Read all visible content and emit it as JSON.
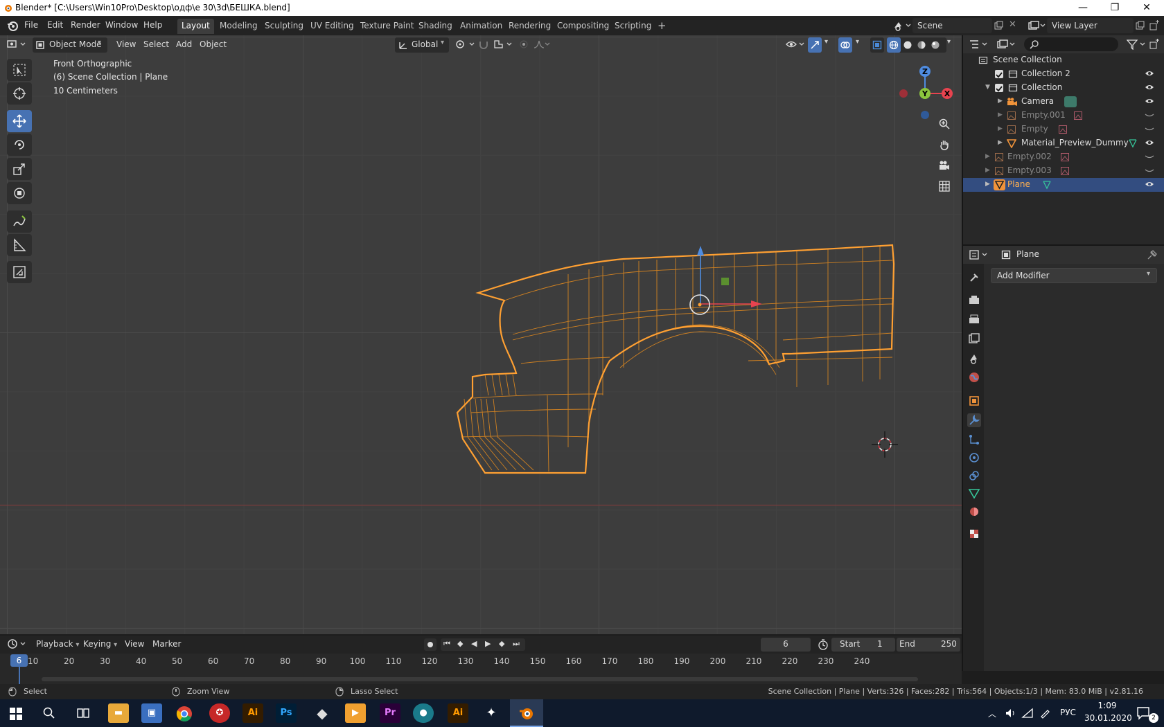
{
  "window": {
    "title": "Blender* [C:\\Users\\Win10Pro\\Desktop\\одф\\е 30\\3d\\БЕШКА.blend]",
    "minimize": "—",
    "maximize": "❐",
    "close": "✕"
  },
  "menu": [
    "File",
    "Edit",
    "Render",
    "Window",
    "Help"
  ],
  "workspaces": [
    "Layout",
    "Modeling",
    "Sculpting",
    "UV Editing",
    "Texture Paint",
    "Shading",
    "Animation",
    "Rendering",
    "Compositing",
    "Scripting"
  ],
  "workspace_add": "+",
  "scene": {
    "name": "Scene",
    "view_layer": "View Layer"
  },
  "viewport": {
    "mode": "Object Mode",
    "menus": [
      "View",
      "Select",
      "Add",
      "Object"
    ],
    "orientation": "Global",
    "overlay_text": [
      "Front Orthographic",
      "(6) Scene Collection | Plane",
      "10 Centimeters"
    ],
    "gizmo_labels": {
      "z": "Z",
      "y": "Y",
      "x": "X"
    }
  },
  "outliner": {
    "search_placeholder": "",
    "rows": [
      {
        "label": "Scene Collection",
        "level": 0,
        "type": "collection-root"
      },
      {
        "label": "Collection 2",
        "level": 1,
        "type": "collection",
        "checked": true
      },
      {
        "label": "Collection",
        "level": 1,
        "type": "collection",
        "checked": true
      },
      {
        "label": "Camera",
        "level": 2,
        "type": "camera"
      },
      {
        "label": "Empty.001",
        "level": 2,
        "type": "empty",
        "dim": true
      },
      {
        "label": "Empty",
        "level": 2,
        "type": "empty",
        "dim": true
      },
      {
        "label": "Material_Preview_Dummy",
        "level": 2,
        "type": "mesh"
      },
      {
        "label": "Empty.002",
        "level": 1,
        "type": "empty",
        "dim": true
      },
      {
        "label": "Empty.003",
        "level": 1,
        "type": "empty",
        "dim": true
      },
      {
        "label": "Plane",
        "level": 1,
        "type": "mesh",
        "selected": true
      }
    ]
  },
  "properties": {
    "object_name": "Plane",
    "add_modifier": "Add Modifier",
    "active_tab": "modifier"
  },
  "timeline": {
    "menus": [
      "Playback",
      "Keying",
      "View",
      "Marker"
    ],
    "current_frame": "6",
    "start_label": "Start",
    "start": "1",
    "end_label": "End",
    "end": "250",
    "ticks": [
      "10",
      "20",
      "30",
      "40",
      "50",
      "60",
      "70",
      "80",
      "90",
      "100",
      "110",
      "120",
      "130",
      "140",
      "150",
      "160",
      "170",
      "180",
      "190",
      "200",
      "210",
      "220",
      "230",
      "240"
    ]
  },
  "statusbar": {
    "select": "Select",
    "zoom": "Zoom View",
    "lasso": "Lasso Select",
    "info": "Scene Collection | Plane | Verts:326 | Faces:282 | Tris:564 | Objects:1/3 | Mem: 83.0 MiB | v2.81.16"
  },
  "taskbar": {
    "apps": [
      "windows-start",
      "search",
      "task-view",
      "file-explorer",
      "store",
      "chrome",
      "app-red",
      "illustrator",
      "photoshop",
      "app-inkscape",
      "app-video",
      "premiere",
      "app-teal",
      "illustrator-2",
      "app-blender-alt",
      "blender"
    ],
    "lang": "РУС",
    "time": "1:09",
    "date": "30.01.2020",
    "notifications": "2"
  },
  "colors": {
    "accent": "#4772b3",
    "selection_orange": "#ffa032",
    "outliner_selected": "#334d80",
    "x_axis": "#e8434f",
    "y_axis": "#8cc63e",
    "z_axis": "#4f8ce0"
  }
}
